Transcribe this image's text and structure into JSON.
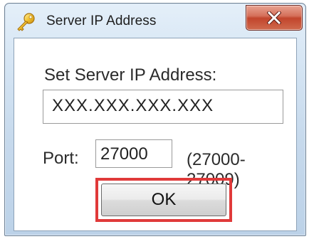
{
  "window": {
    "title": "Server IP Address",
    "title_icon": "key-icon",
    "close_icon": "close-icon",
    "close_color": "#c7452c"
  },
  "form": {
    "prompt": "Set Server IP Address:",
    "ip_value": "XXX.XXX.XXX.XXX",
    "port_label": "Port:",
    "port_value": "27000",
    "port_range": "(27000-27009)",
    "ok_label": "OK",
    "highlight_color": "#e03a3a"
  }
}
